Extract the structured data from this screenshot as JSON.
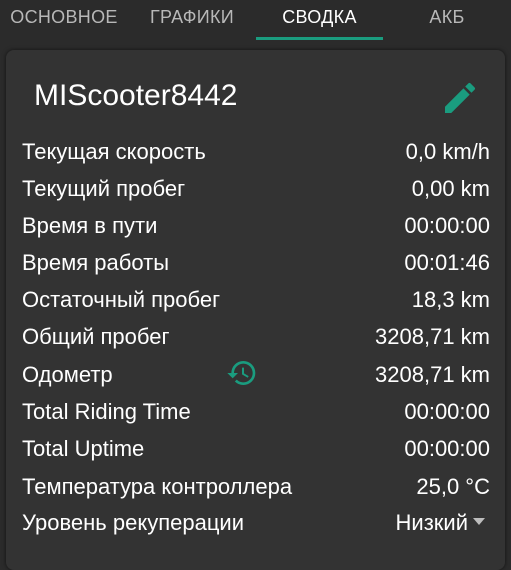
{
  "tabs": [
    {
      "label": "ОСНОВНОЕ"
    },
    {
      "label": "ГРАФИКИ"
    },
    {
      "label": "СВОДКА"
    },
    {
      "label": "АКБ"
    }
  ],
  "active_tab": "СВОДКА",
  "colors": {
    "accent": "#1a9c7f",
    "background": "#2b2b2b",
    "card": "#333333"
  },
  "summary": {
    "device_name": "MIScooter8442",
    "rows": [
      {
        "label": "Текущая скорость",
        "value": "0,0 km/h"
      },
      {
        "label": "Текущий пробег",
        "value": "0,00 km"
      },
      {
        "label": "Время в пути",
        "value": "00:00:00"
      },
      {
        "label": "Время работы",
        "value": "00:01:46"
      },
      {
        "label": "Остаточный пробег",
        "value": "18,3 km"
      },
      {
        "label": "Общий пробег",
        "value": "3208,71 km"
      },
      {
        "label": "Одометр",
        "value": "3208,71 km"
      },
      {
        "label": "Total Riding Time",
        "value": "00:00:00"
      },
      {
        "label": "Total Uptime",
        "value": "00:00:00"
      },
      {
        "label": "Температура контроллера",
        "value": "25,0 °C"
      },
      {
        "label": "Уровень рекуперации",
        "value": "Низкий"
      }
    ]
  },
  "icons": {
    "edit": "pencil-icon",
    "odometer_reset": "history-icon",
    "dropdown": "dropdown-arrow-icon"
  }
}
